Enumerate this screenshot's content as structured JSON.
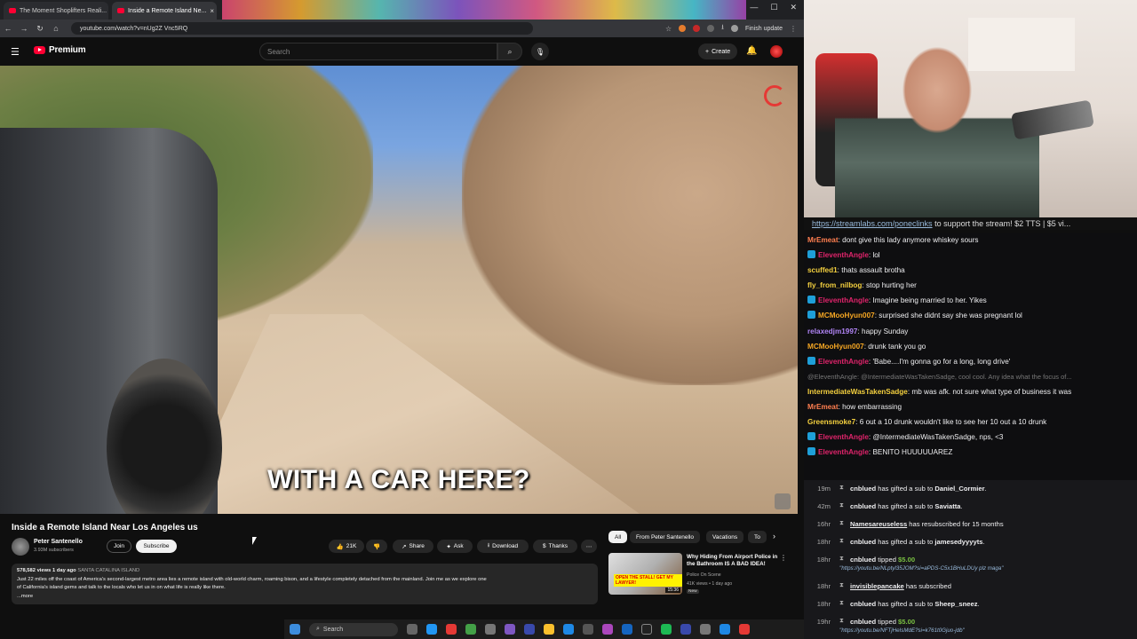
{
  "browser": {
    "tabs": [
      {
        "label": "The Moment Shoplifters Reali...",
        "active": false
      },
      {
        "label": "Inside a Remote Island Ne...",
        "active": true
      }
    ],
    "url": "youtube.com/watch?v=nUg2Z Vnc5RQ",
    "finish_update": "Finish update"
  },
  "youtube": {
    "logo_text": "Premium",
    "search_placeholder": "Search",
    "create_label": "Create",
    "video": {
      "caption": "WITH A CAR HERE?",
      "title": "Inside a Remote Island Near Los Angeles us",
      "channel": "Peter Santenello",
      "subscribers": "3.93M subscribers",
      "join_label": "Join",
      "subscribe_label": "Subscribe",
      "likes": "21K",
      "share_label": "Share",
      "ask_label": "Ask",
      "download_label": "Download",
      "thanks_label": "Thanks",
      "views_date": "578,582 views  1 day ago",
      "location": "SANTA CATALINA ISLAND",
      "description_line1": "Just 22 miles off the coast of America's second-largest metro area lies a remote island with old-world charm, roaming bison, and a lifestyle completely detached from the mainland. Join me as we explore one",
      "description_line2": "of California's island gems and talk to the locals who let us in on what life is really like there.",
      "more_label": "...more"
    },
    "chips": [
      "All",
      "From Peter Santenello",
      "Vacations",
      "To"
    ],
    "related": {
      "title": "Why Hiding From Airport Police in the Bathroom IS A BAD IDEA!",
      "thumb_text": "OPEN THE STALL! GET MY LAWYER!",
      "duration": "15:36",
      "channel": "Police On Scene",
      "views": "41K views • 1 day ago",
      "badge": "New"
    }
  },
  "stream": {
    "banner_link": "https://streamlabs.com/poneclinks",
    "banner_text": " to support the stream! $2 TTS | $5 vi...",
    "chat": [
      {
        "user": "MrEmeat",
        "color": "#ff7f50",
        "badge": false,
        "text": "dont give this lady anymore whiskey sours"
      },
      {
        "user": "EleventhAngle",
        "color": "#e0246b",
        "badge": true,
        "text": "lol"
      },
      {
        "user": "scuffed1",
        "color": "#f4d03f",
        "badge": false,
        "text": "thats assault brotha"
      },
      {
        "user": "fly_from_nilbog",
        "color": "#f4d03f",
        "badge": false,
        "text": "stop hurting her"
      },
      {
        "user": "EleventhAngle",
        "color": "#e0246b",
        "badge": true,
        "text": "Imagine being married to her. Yikes"
      },
      {
        "user": "MCMooHyun007",
        "color": "#f5a623",
        "badge": true,
        "text": "surprised she didnt say she was pregnant lol"
      },
      {
        "user": "relaxedjm1997",
        "color": "#b084f5",
        "badge": false,
        "text": "happy Sunday"
      },
      {
        "user": "MCMooHyun007",
        "color": "#f5a623",
        "badge": false,
        "text": "drunk tank you go"
      },
      {
        "user": "EleventhAngle",
        "color": "#e0246b",
        "badge": true,
        "text": "'Babe....I'm gonna go for a long, long drive'"
      },
      {
        "user": "",
        "color": "#777",
        "badge": false,
        "text": "@EleventhAngle: @IntermediateWasTakenSadge, cool cool. Any idea what the focus of...",
        "faded": true
      },
      {
        "user": "IntermediateWasTakenSadge",
        "color": "#f4d03f",
        "badge": false,
        "text": "mb was afk. not sure what type of business it was"
      },
      {
        "user": "MrEmeat",
        "color": "#ff7f50",
        "badge": false,
        "text": "how embarrassing"
      },
      {
        "user": "Greensmoke7",
        "color": "#f4d03f",
        "badge": false,
        "text": "6 out a 10 drunk wouldn't like to see her 10 out a 10 drunk"
      },
      {
        "user": "EleventhAngle",
        "color": "#e0246b",
        "badge": true,
        "text": "@IntermediateWasTakenSadge, nps, <3"
      },
      {
        "user": "EleventhAngle",
        "color": "#e0246b",
        "badge": true,
        "text": "BENITO HUUUUUAREZ"
      }
    ],
    "events": [
      {
        "time": "19m",
        "user": "cnblued",
        "text": " has gifted a sub to ",
        "target": "Daniel_Cormier",
        "end": "."
      },
      {
        "time": "42m",
        "user": "cnblued",
        "text": " has gifted a sub to ",
        "target": "Saviatta",
        "end": "."
      },
      {
        "time": "16hr",
        "user": "Namesareuseless",
        "text": " has resubscribed for 15 months",
        "target": "",
        "end": "",
        "underline": true
      },
      {
        "time": "18hr",
        "user": "cnblued",
        "text": " has gifted a sub to ",
        "target": "jamesedyyyyts",
        "end": "."
      },
      {
        "time": "18hr",
        "user": "cnblued",
        "text": " tipped ",
        "target": "",
        "money": "$5.00",
        "end": "",
        "note": "\"https://youtu.be/NLptyl35JOM?si=aPDS-C5x1BHuLDUy plz maga\""
      },
      {
        "time": "18hr",
        "user": "invisiblepancake",
        "text": " has subscribed",
        "target": "",
        "end": "",
        "underline": true
      },
      {
        "time": "18hr",
        "user": "cnblued",
        "text": " has gifted a sub to ",
        "target": "Sheep_sneez",
        "end": "."
      },
      {
        "time": "19hr",
        "user": "cnblued",
        "text": " tipped ",
        "target": "",
        "money": "$5.00",
        "end": "",
        "note": "\"https://youtu.be/NFTjHeIsMdE?si=k761t0Gjuo-jdb\""
      }
    ]
  },
  "taskbar": {
    "search_label": "Search"
  }
}
